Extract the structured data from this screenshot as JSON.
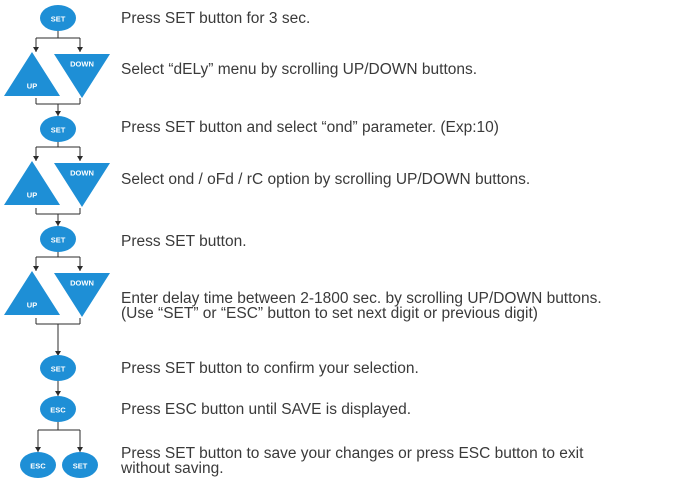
{
  "buttons": {
    "set": "SET",
    "up": "UP",
    "down": "DOWN",
    "esc": "ESC"
  },
  "colors": {
    "button_fill": "#1e8fd6",
    "connector": "#2b2b2b",
    "text": "#3a3a3a"
  },
  "steps": [
    {
      "lines": [
        "Press SET button for 3 sec."
      ]
    },
    {
      "lines": [
        "Select “dELy” menu by scrolling UP/DOWN buttons."
      ]
    },
    {
      "lines": [
        "Press SET button and select “ond” parameter. (Exp:10)"
      ]
    },
    {
      "lines": [
        "Select  ond / oFd / rC  option by scrolling UP/DOWN buttons."
      ]
    },
    {
      "lines": [
        "Press SET button."
      ]
    },
    {
      "lines": [
        "Enter delay time between 2-1800 sec. by scrolling UP/DOWN buttons.",
        "(Use “SET” or “ESC” button to set next digit or previous digit)"
      ]
    },
    {
      "lines": [
        "Press SET button to confirm your selection."
      ]
    },
    {
      "lines": [
        "Press ESC button until SAVE is displayed."
      ]
    },
    {
      "lines": [
        "Press SET button to save your changes or press ESC button to exit",
        "without saving."
      ]
    }
  ]
}
